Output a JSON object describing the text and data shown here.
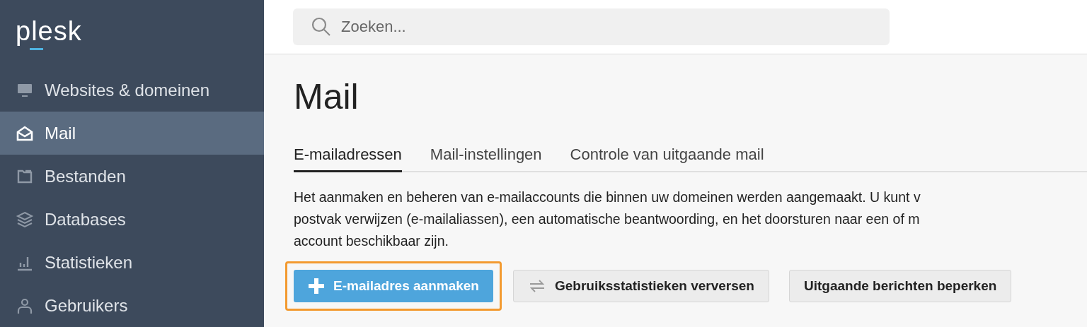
{
  "sidebar": {
    "logo": "plesk",
    "items": [
      {
        "label": "Websites & domeinen",
        "selected": false
      },
      {
        "label": "Mail",
        "selected": true
      },
      {
        "label": "Bestanden",
        "selected": false
      },
      {
        "label": "Databases",
        "selected": false
      },
      {
        "label": "Statistieken",
        "selected": false
      },
      {
        "label": "Gebruikers",
        "selected": false
      }
    ]
  },
  "search": {
    "placeholder": "Zoeken..."
  },
  "page": {
    "title": "Mail",
    "tabs": [
      {
        "label": "E-mailadressen",
        "selected": true
      },
      {
        "label": "Mail-instellingen",
        "selected": false
      },
      {
        "label": "Controle van uitgaande mail",
        "selected": false
      }
    ],
    "description_lines": [
      "Het aanmaken en beheren van e-mailaccounts die binnen uw domeinen werden aangemaakt. U kunt v",
      "postvak verwijzen (e-mailaliassen), een automatische beantwoording, en het doorsturen naar een of m",
      "account beschikbaar zijn."
    ],
    "buttons": [
      {
        "label": "E-mailadres aanmaken",
        "kind": "primary",
        "highlighted": true
      },
      {
        "label": "Gebruiksstatistieken verversen",
        "kind": "secondary",
        "highlighted": false
      },
      {
        "label": "Uitgaande berichten beperken",
        "kind": "secondary",
        "highlighted": false
      }
    ]
  }
}
